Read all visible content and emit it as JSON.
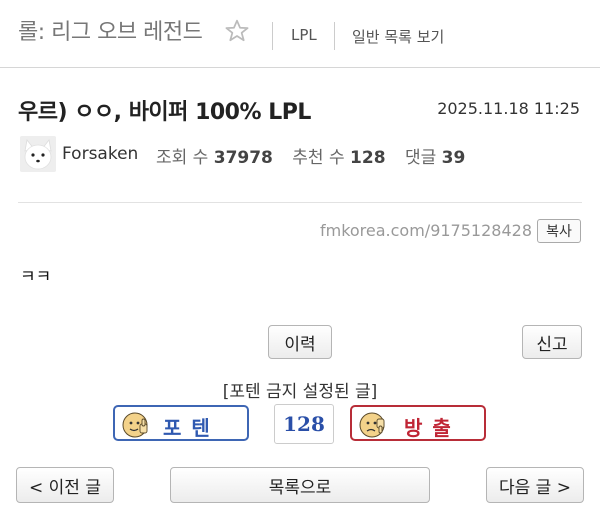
{
  "header": {
    "board_title": "롤: 리그 오브 레전드",
    "category": "LPL",
    "list_link": "일반 목록 보기"
  },
  "post": {
    "title": "우르) ㅇㅇ, 바이퍼 100% LPL",
    "date": "2025.11.18 11:25",
    "author": "Forsaken",
    "views_label": "조회 수",
    "views": "37978",
    "recommend_label": "추천 수",
    "recommend": "128",
    "comments_label": "댓글",
    "comments": "39",
    "url": "fmkorea.com/9175128428",
    "copy_label": "복사",
    "body": "ㅋㅋ"
  },
  "actions": {
    "history_label": "이력",
    "report_label": "신고",
    "notice": "[포텐 금지 설정된 글]",
    "vote_up_label": "포텐",
    "vote_count": "128",
    "vote_down_label": "방출",
    "prev_label": "< 이전 글",
    "list_label": "목록으로",
    "next_label": "다음 글 >"
  },
  "colors": {
    "vote_up": "#2f59b0",
    "vote_down": "#c02535"
  }
}
